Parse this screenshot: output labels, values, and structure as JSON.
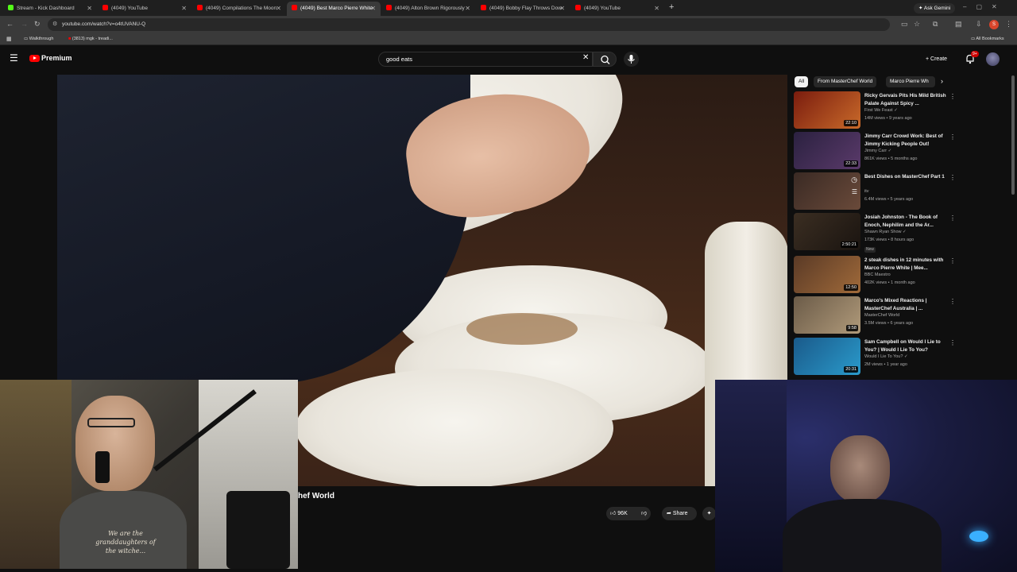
{
  "browser": {
    "tabs": [
      {
        "label": "Stream - Kick Dashboard",
        "favicon_color": "#53fc18",
        "active": false
      },
      {
        "label": "(4049) YouTube",
        "favicon_color": "#ff0000",
        "active": false
      },
      {
        "label": "(4049) Compilations The Moon",
        "favicon_color": "#ff0000",
        "active": false
      },
      {
        "label": "(4049) Best Marco Pierre White",
        "favicon_color": "#ff0000",
        "active": true
      },
      {
        "label": "(4049) Alton Brown Rigorously",
        "favicon_color": "#ff0000",
        "active": false
      },
      {
        "label": "(4049) Bobby Flay Throws Dow",
        "favicon_color": "#ff0000",
        "active": false
      },
      {
        "label": "(4049) YouTube",
        "favicon_color": "#ff0000",
        "active": false
      }
    ],
    "new_tab": "+",
    "ask_gemini": "Ask Gemini",
    "url": "youtube.com/watch?v=o4tUVANU-Q",
    "bookmarks": [
      "Walkthrough",
      "(3813) mgk - treadi..."
    ],
    "all_bookmarks": "All Bookmarks",
    "profile_letter": "S"
  },
  "youtube": {
    "logo_text": "Premium",
    "search_value": "good eats",
    "create_label": "Create",
    "notification_badge": "9+"
  },
  "video": {
    "title_fragment": "hef World",
    "like_count": "96K",
    "share_label": "Share"
  },
  "chips": [
    "All",
    "From MasterChef World",
    "Marco Pierre Wh"
  ],
  "recommendations": [
    {
      "title": "Ricky Gervais Pits His Mild British Palate Against Spicy ...",
      "channel": "First We Feast",
      "meta": "14M views • 9 years ago",
      "duration": "22:10",
      "new": "",
      "thumb_color": "#7a1c0e"
    },
    {
      "title": "Jimmy Carr Crowd Work: Best of Jimmy Kicking People Out!",
      "channel": "Jimmy Carr",
      "meta": "861K views • 5 months ago",
      "duration": "22:33",
      "new": "",
      "thumb_color": "#2b2140"
    },
    {
      "title": "Best Dishes on MasterChef Part 1",
      "channel": "itv",
      "meta": "6.4M views • 5 years ago",
      "duration": "",
      "new": "",
      "thumb_color": "#3a2a24"
    },
    {
      "title": "Josiah Johnston - The Book of Enoch, Nephilim and the Ar...",
      "channel": "Shawn Ryan Show",
      "meta": "173K views • 8 hours ago",
      "duration": "2:50:21",
      "new": "New",
      "thumb_color": "#3b2e22"
    },
    {
      "title": "2 steak dishes in 12 minutes with Marco Pierre White | Mee...",
      "channel": "BBC Maestro",
      "meta": "402K views • 1 month ago",
      "duration": "12:50",
      "new": "",
      "thumb_color": "#5a3a26"
    },
    {
      "title": "Marco's Mixed Reactions | MasterChef Australia | ...",
      "channel": "MasterChef World",
      "meta": "3.5M views • 6 years ago",
      "duration": "9:58",
      "new": "",
      "thumb_color": "#6b5b48"
    },
    {
      "title": "Sam Campbell on Would I Lie to You? | Would I Lie To You?",
      "channel": "Would I Lie To You?",
      "meta": "2M views • 1 year ago",
      "duration": "20:31",
      "new": "",
      "thumb_color": "#1a5a8a"
    }
  ],
  "overlays": {
    "shirt_text": "We are the granddaughters of the witche..."
  }
}
